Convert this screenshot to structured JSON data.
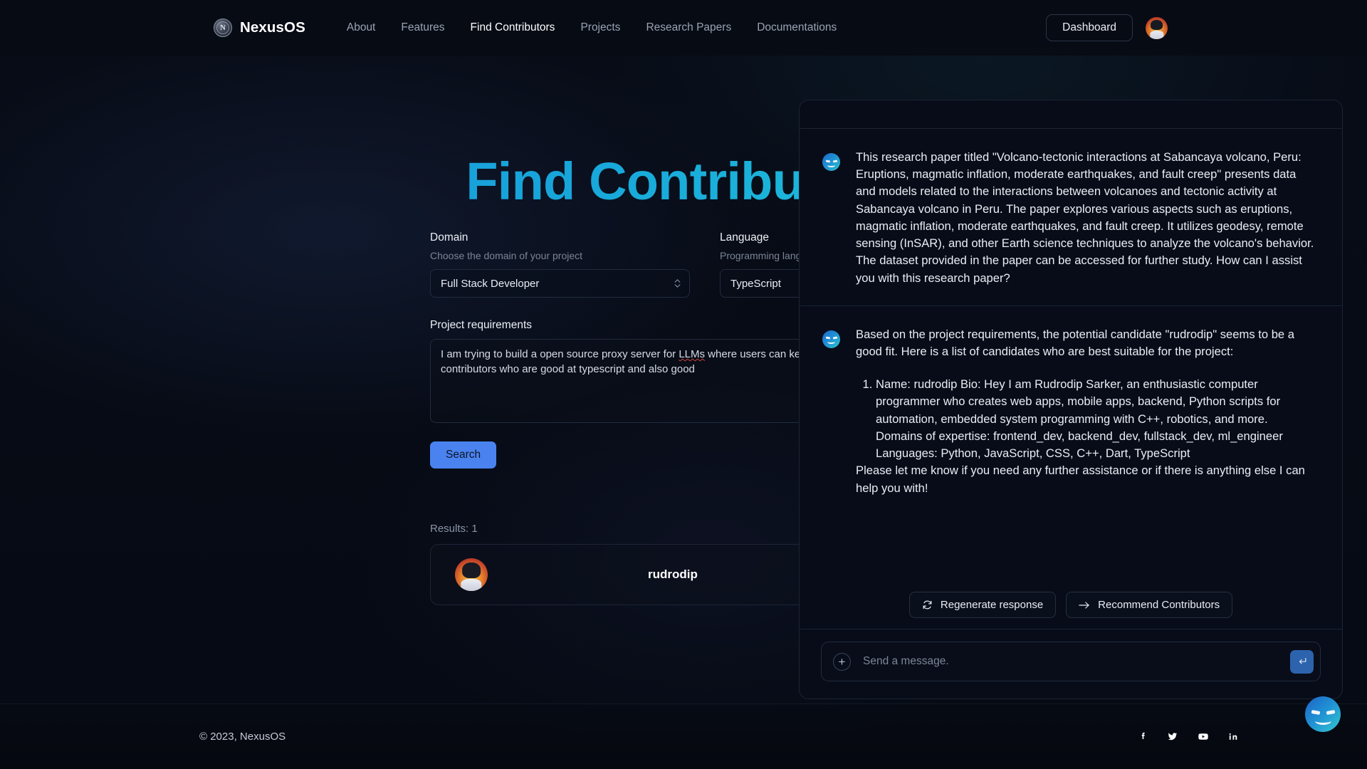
{
  "brand": {
    "name": "NexusOS",
    "logo_icon": "compass-logo-icon",
    "logo_letter": "N"
  },
  "nav": {
    "links": [
      {
        "label": "About",
        "active": false
      },
      {
        "label": "Features",
        "active": false
      },
      {
        "label": "Find Contributors",
        "active": true
      },
      {
        "label": "Projects",
        "active": false
      },
      {
        "label": "Research Papers",
        "active": false
      },
      {
        "label": "Documentations",
        "active": false
      }
    ],
    "dashboard_label": "Dashboard",
    "avatar_icon": "user-avatar"
  },
  "hero": {
    "title": "Find Contributors"
  },
  "form": {
    "domain": {
      "label": "Domain",
      "help": "Choose the domain of your project",
      "value": "Full Stack Developer"
    },
    "language": {
      "label": "Language",
      "help": "Programming language t",
      "value": "TypeScript"
    },
    "requirements": {
      "label": "Project requirements",
      "line1_a": "I am trying to build a open source proxy server for ",
      "line1_b": "LLMs",
      "line1_c": " where users can keep",
      "line2": "real-time. I need some contributors who are good at typescript and also good"
    },
    "search_label": "Search"
  },
  "results": {
    "count_label": "Results: 1",
    "items": [
      {
        "name": "rudrodip",
        "avatar_icon": "contributor-avatar"
      }
    ]
  },
  "chat": {
    "messages": [
      {
        "avatar_icon": "bot-avatar-icon",
        "paragraphs": [
          "This research paper titled \"Volcano-tectonic interactions at Sabancaya volcano, Peru: Eruptions, magmatic inflation, moderate earthquakes, and fault creep\" presents data and models related to the interactions between volcanoes and tectonic activity at Sabancaya volcano in Peru. The paper explores various aspects such as eruptions, magmatic inflation, moderate earthquakes, and fault creep. It utilizes geodesy, remote sensing (InSAR), and other Earth science techniques to analyze the volcano's behavior. The dataset provided in the paper can be accessed for further study. How can I assist you with this research paper?"
        ],
        "list": [],
        "tail": ""
      },
      {
        "avatar_icon": "bot-avatar-icon",
        "paragraphs": [
          "Based on the project requirements, the potential candidate \"rudrodip\" seems to be a good fit. Here is a list of candidates who are best suitable for the project:"
        ],
        "list": [
          "Name: rudrodip Bio: Hey I am Rudrodip Sarker, an enthusiastic computer programmer who creates web apps, mobile apps, backend, Python scripts for automation, embedded system programming with C++, robotics, and more. Domains of expertise: frontend_dev, backend_dev, fullstack_dev, ml_engineer Languages: Python, JavaScript, CSS, C++, Dart, TypeScript"
        ],
        "tail": "Please let me know if you need any further assistance or if there is anything else I can help you with!"
      }
    ],
    "actions": [
      {
        "label": "Regenerate response",
        "icon": "refresh-icon"
      },
      {
        "label": "Recommend Contributors",
        "icon": "arrow-right-icon"
      }
    ],
    "input": {
      "placeholder": "Send a message.",
      "plus_icon": "plus-icon",
      "send_icon": "enter-return-icon"
    }
  },
  "fab": {
    "icon": "chat-bot-face-icon"
  },
  "footer": {
    "copyright": "© 2023, NexusOS",
    "socials": [
      {
        "name": "facebook-icon"
      },
      {
        "name": "twitter-icon"
      },
      {
        "name": "youtube-icon"
      },
      {
        "name": "linkedin-icon"
      }
    ]
  },
  "colors": {
    "accent_blue": "#4a83f0",
    "hero_gradient_from": "#1f8fd6",
    "hero_gradient_to": "#24cddb",
    "background": "#060a14",
    "send_button": "#2d63ad"
  }
}
